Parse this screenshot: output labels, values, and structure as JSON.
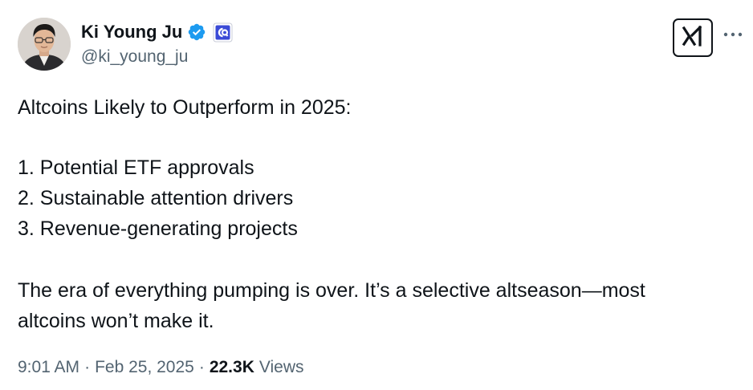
{
  "author": {
    "display_name": "Ki Young Ju",
    "handle": "@ki_young_ju",
    "verified_badge_color": "#1d9bf0",
    "affiliate_badge_color": "#3a4ad6",
    "icons": {
      "verified": "verified-badge-icon",
      "affiliate": "cryptoquant-affiliate-icon",
      "grok": "grok-icon",
      "more": "more-dots-icon"
    }
  },
  "tweet": {
    "lines": [
      "Altcoins Likely to Outperform in 2025:",
      "1. Potential ETF approvals",
      "2. Sustainable attention drivers",
      "3. Revenue-generating projects",
      "The era of everything pumping is over. It’s a selective altseason—most",
      "altcoins won’t make it."
    ]
  },
  "meta": {
    "time": "9:01 AM",
    "separator": "·",
    "date": "Feb 25, 2025",
    "views_count": "22.3K",
    "views_label": "Views"
  },
  "colors": {
    "text_primary": "#0f1419",
    "text_secondary": "#536471",
    "background": "#ffffff"
  }
}
